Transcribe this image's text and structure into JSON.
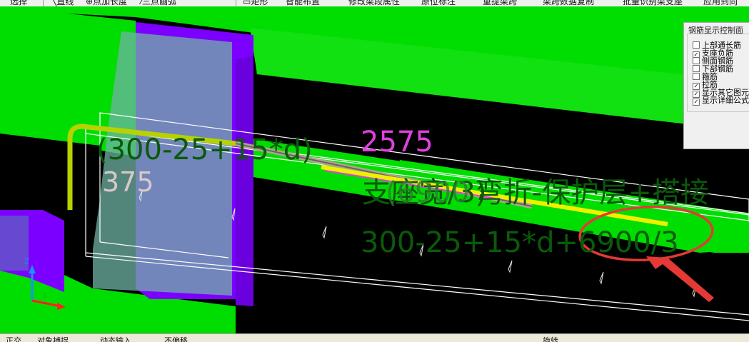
{
  "toolbar": {
    "items": [
      "选择",
      "直线",
      "点加长度",
      "三点画弧",
      "矩形",
      "智能布置",
      "修改梁段属性",
      "原位标注",
      "重提梁跨",
      "梁跨数据复制",
      "批量识别梁支座",
      "应用到同"
    ]
  },
  "scene": {
    "annotations": {
      "formula_top": "(300-25+15*d)",
      "value_375": "375",
      "value_2575": "2575",
      "overlap_text": "支座宽/3)",
      "overlap_text_2": "(6900",
      "desc_text": "弯折-保护层+搭接",
      "formula_main": "300-25+15*d+6900/3"
    },
    "axis": {
      "z": "Z",
      "y": "Y"
    },
    "colors": {
      "green": "#00dd00",
      "purple": "#7b00ff",
      "teal_overlay": "#6fb3a4",
      "red_mark": "#e53935",
      "yellow_bar": "#f0f000",
      "magenta_text": "#e040e0"
    }
  },
  "panel": {
    "title": "钢筋显示控制面",
    "options": [
      {
        "label": "上部通长筋",
        "checked": false
      },
      {
        "label": "支座负筋",
        "checked": true
      },
      {
        "label": "侧面钢筋",
        "checked": false
      },
      {
        "label": "下部钢筋",
        "checked": false
      },
      {
        "label": "箍筋",
        "checked": false
      },
      {
        "label": "拉筋",
        "checked": true
      },
      {
        "label": "显示其它图元",
        "checked": true
      },
      {
        "label": "显示详细公式",
        "checked": true
      }
    ]
  },
  "statusbar": {
    "items": [
      "正交",
      "对象捕捉",
      "动态输入",
      "不偏移",
      "旋转"
    ]
  }
}
